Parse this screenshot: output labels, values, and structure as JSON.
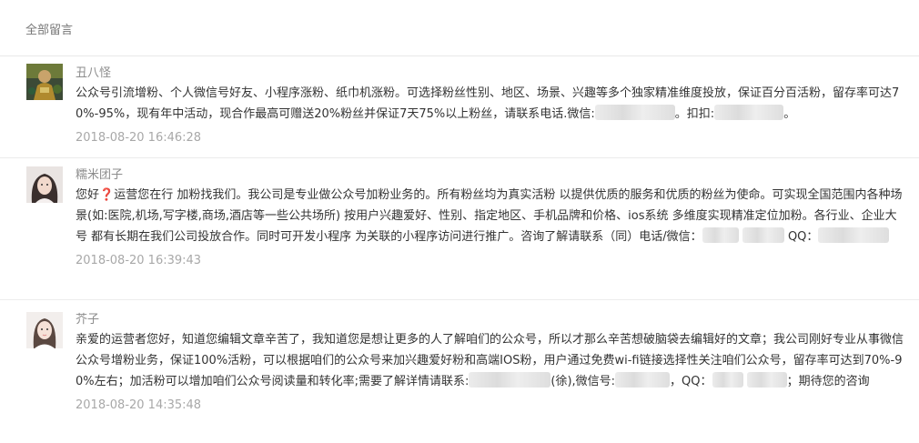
{
  "header": {
    "title": "全部留言"
  },
  "comments": [
    {
      "nickname": "丑八怪",
      "content_a": "公众号引流增粉、个人微信号好友、小程序涨粉、纸巾机涨粉。可选择粉丝性别、地区、场景、兴趣等多个独家精准维度投放，保证百分百活粉，留存率可达70%-95%，现有年中活动，现合作最高可赠送20%粉丝并保证7天75%以上粉丝，请联系电话.微信:",
      "content_b": "。扣扣:",
      "content_c": "。",
      "time": "2018-08-20 16:46:28"
    },
    {
      "nickname": "糯米团子",
      "content_a": "您好",
      "emoji": "❓",
      "content_b": "运营您在行 加粉找我们。我公司是专业做公众号加粉业务的。所有粉丝均为真实活粉 以提供优质的服务和优质的粉丝为使命。可实现全国范围内各种场景(如:医院,机场,写字楼,商场,酒店等一些公共场所) 按用户兴趣爱好、性别、指定地区、手机品牌和价格、ios系统 多维度实现精准定位加粉。各行业、企业大号 都有长期在我们公司投放合作。同时可开发小程序 为关联的小程序访问进行推广。咨询了解请联系（同）电话/微信：",
      "content_c": "QQ：",
      "time": "2018-08-20 16:39:43"
    },
    {
      "nickname": "芥子",
      "content_a": "亲爱的运营者您好，知道您编辑文章辛苦了，我知道您是想让更多的人了解咱们的公众号，所以才那么辛苦想破脑袋去编辑好的文章；我公司刚好专业从事微信公众号增粉业务，保证100%活粉，可以根据咱们的公众号来加兴趣爱好粉和高端IOS粉，用户通过免费wi-fi链接选择性关注咱们公众号，留存率可达到70%-90%左右；加活粉可以增加咱们公众号阅读量和转化率;需要了解详情请联系:",
      "content_b": "(徐),微信号:",
      "content_c": "，QQ：",
      "content_d": "；期待您的咨询",
      "time": "2018-08-20 14:35:48"
    }
  ]
}
